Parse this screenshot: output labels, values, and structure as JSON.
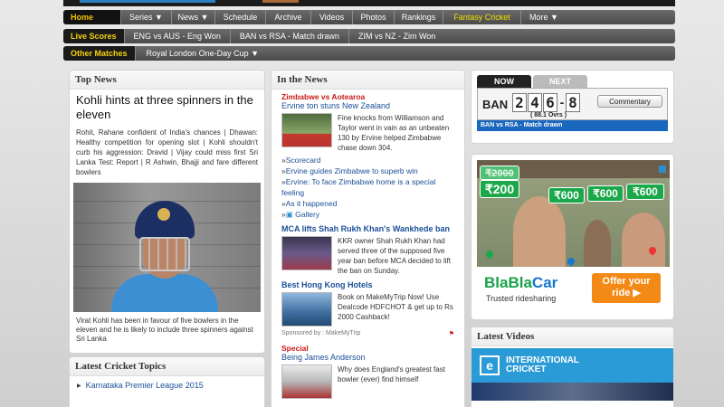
{
  "nav": {
    "home": "Home",
    "items": [
      "Series ▼",
      "News ▼",
      "Schedule",
      "Archive",
      "Videos",
      "Photos",
      "Rankings",
      "Fantasy Cricket",
      "More ▼"
    ]
  },
  "live": {
    "label": "Live Scores",
    "items": [
      "ENG vs AUS - Eng Won",
      "BAN vs RSA - Match drawn",
      "ZIM vs NZ - Zim Won"
    ]
  },
  "other": {
    "label": "Other Matches",
    "item": "Royal London One-Day Cup ▼"
  },
  "top_news": {
    "title": "Top News",
    "headline": "Kohli hints at three spinners in the eleven",
    "blurb": "Rohit, Rahane confident of India's chances | Dhawan: Healthy competition for opening slot | Kohli shouldn't curb his aggression: Dravid | Vijay could miss first Sri Lanka Test: Report | R Ashwin, Bhajji and fare different bowlers",
    "caption": "Virat Kohli has been in favour of five bowlers in the eleven and he is likely to include three spinners against Sri Lanka"
  },
  "topics": {
    "title": "Latest Cricket Topics",
    "items": [
      "Karnataka Premier League 2015"
    ]
  },
  "in_the_news": {
    "title": "In the News",
    "s1_title": "Zimbabwe vs Aotearoa",
    "s1_sub": "Ervine ton stuns New Zealand",
    "s1_text": "Fine knocks from Williamson and Taylor went in vain as an unbeaten 130 by Ervine helped Zimbabwe chase down 304.",
    "s1_links": [
      "Scorecard",
      "Ervine guides Zimbabwe to superb win",
      "Ervine: To face Zimbabwe home is a special feeling",
      "As it happened",
      "Gallery"
    ],
    "s2_title": "MCA lifts Shah Rukh Khan's Wankhede ban",
    "s2_text": "KKR owner Shah Rukh Khan had served three of the supposed five year ban before MCA decided to lift the ban on Sunday.",
    "s3_title": "Best Hong Kong Hotels",
    "s3_text": "Book on MakeMyTrip Now! Use Dealcode HDFCHOT & get up to Rs 2000 Cashback!",
    "sponsor": "Sponsored by : MakeMyTrip",
    "s4_title": "Special",
    "s4_sub": "Being James Anderson",
    "s4_text": "Why does England's greatest fast bowler (ever) find himself"
  },
  "score": {
    "tab_now": "NOW",
    "tab_next": "NEXT",
    "team": "BAN",
    "runs": [
      "2",
      "4",
      "6"
    ],
    "wickets": "8",
    "overs": "( 88.1 Ovrs )",
    "commentary": "Commentary",
    "footer": "BAN vs RSA - Match drawn"
  },
  "ad": {
    "old_price": "₹2000",
    "price_main": "₹200",
    "prices": [
      "₹600",
      "₹600",
      "₹600"
    ],
    "brand_a": "BlaBla",
    "brand_b": "Car",
    "tagline": "Trusted ridesharing",
    "offer": "Offer your ride ▶"
  },
  "videos": {
    "title": "Latest Videos",
    "banner_logo": "e",
    "banner_line1": "INTERNATIONAL",
    "banner_line2": "CRICKET"
  },
  "colors": {
    "nav_bg": "#5a5a5a",
    "link": "#1b4f98",
    "section_red": "#c81818",
    "score_blue": "#1a67bf",
    "brand_green": "#17a34a",
    "offer_orange": "#f38a16"
  }
}
